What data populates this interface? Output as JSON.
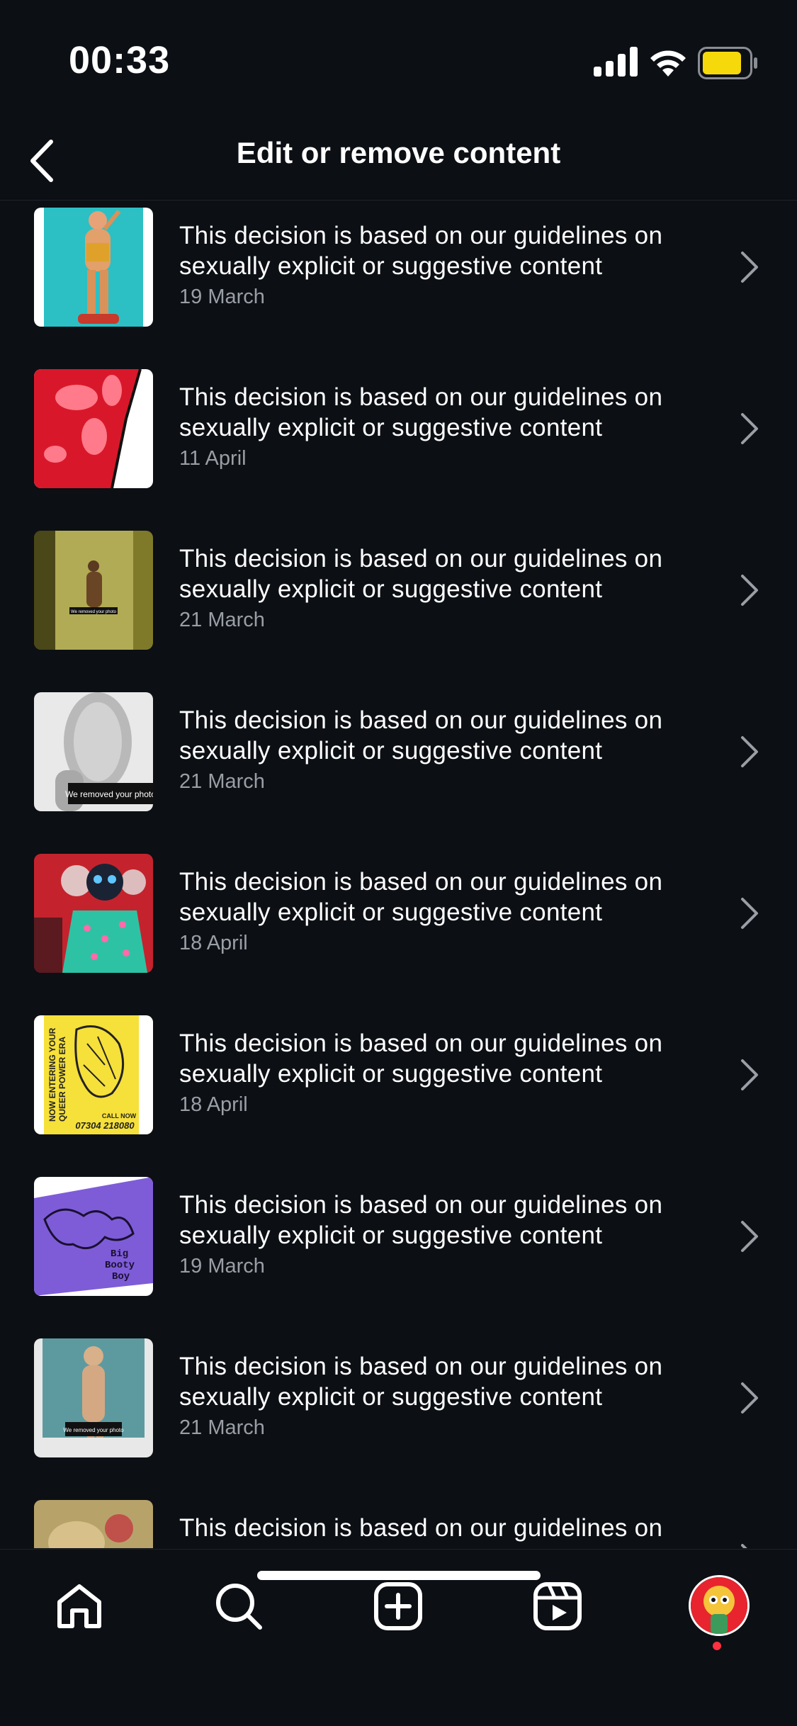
{
  "status_bar": {
    "time": "00:33",
    "battery_color": "#f5d90a"
  },
  "header": {
    "title": "Edit or remove content",
    "back_icon": "chevron-left-icon"
  },
  "items": [
    {
      "reason": "This decision is based on our guidelines on sexually explicit or suggestive content",
      "date": "19 March"
    },
    {
      "reason": "This decision is based on our guidelines on sexually explicit or suggestive content",
      "date": "11 April"
    },
    {
      "reason": "This decision is based on our guidelines on sexually explicit or suggestive content",
      "date": "21 March",
      "thumb_caption": "We removed your photo"
    },
    {
      "reason": "This decision is based on our guidelines on sexually explicit or suggestive content",
      "date": "21 March",
      "thumb_caption": "We removed your photo"
    },
    {
      "reason": "This decision is based on our guidelines on sexually explicit or suggestive content",
      "date": "18 April"
    },
    {
      "reason": "This decision is based on our guidelines on sexually explicit or suggestive content",
      "date": "18 April",
      "thumb_text": [
        "NOW ENTERING YOUR",
        "QUEER POWER ERA",
        "CALL NOW",
        "07304 218080"
      ]
    },
    {
      "reason": "This decision is based on our guidelines on sexually explicit or suggestive content",
      "date": "19 March",
      "thumb_text": [
        "Big",
        "Booty",
        "Boy"
      ]
    },
    {
      "reason": "This decision is based on our guidelines on sexually explicit or suggestive content",
      "date": "21 March",
      "thumb_caption": "We removed your photo"
    },
    {
      "reason": "This decision is based on our guidelines on sexually explicit or suggestive content",
      "date": ""
    }
  ],
  "bottom_nav": {
    "items": [
      "home-icon",
      "search-icon",
      "create-icon",
      "reels-icon",
      "profile-avatar"
    ],
    "notification_color": "#ff3040"
  },
  "colors": {
    "background": "#0c0f14",
    "text": "#ffffff",
    "secondary_text": "#9a9ea5"
  }
}
